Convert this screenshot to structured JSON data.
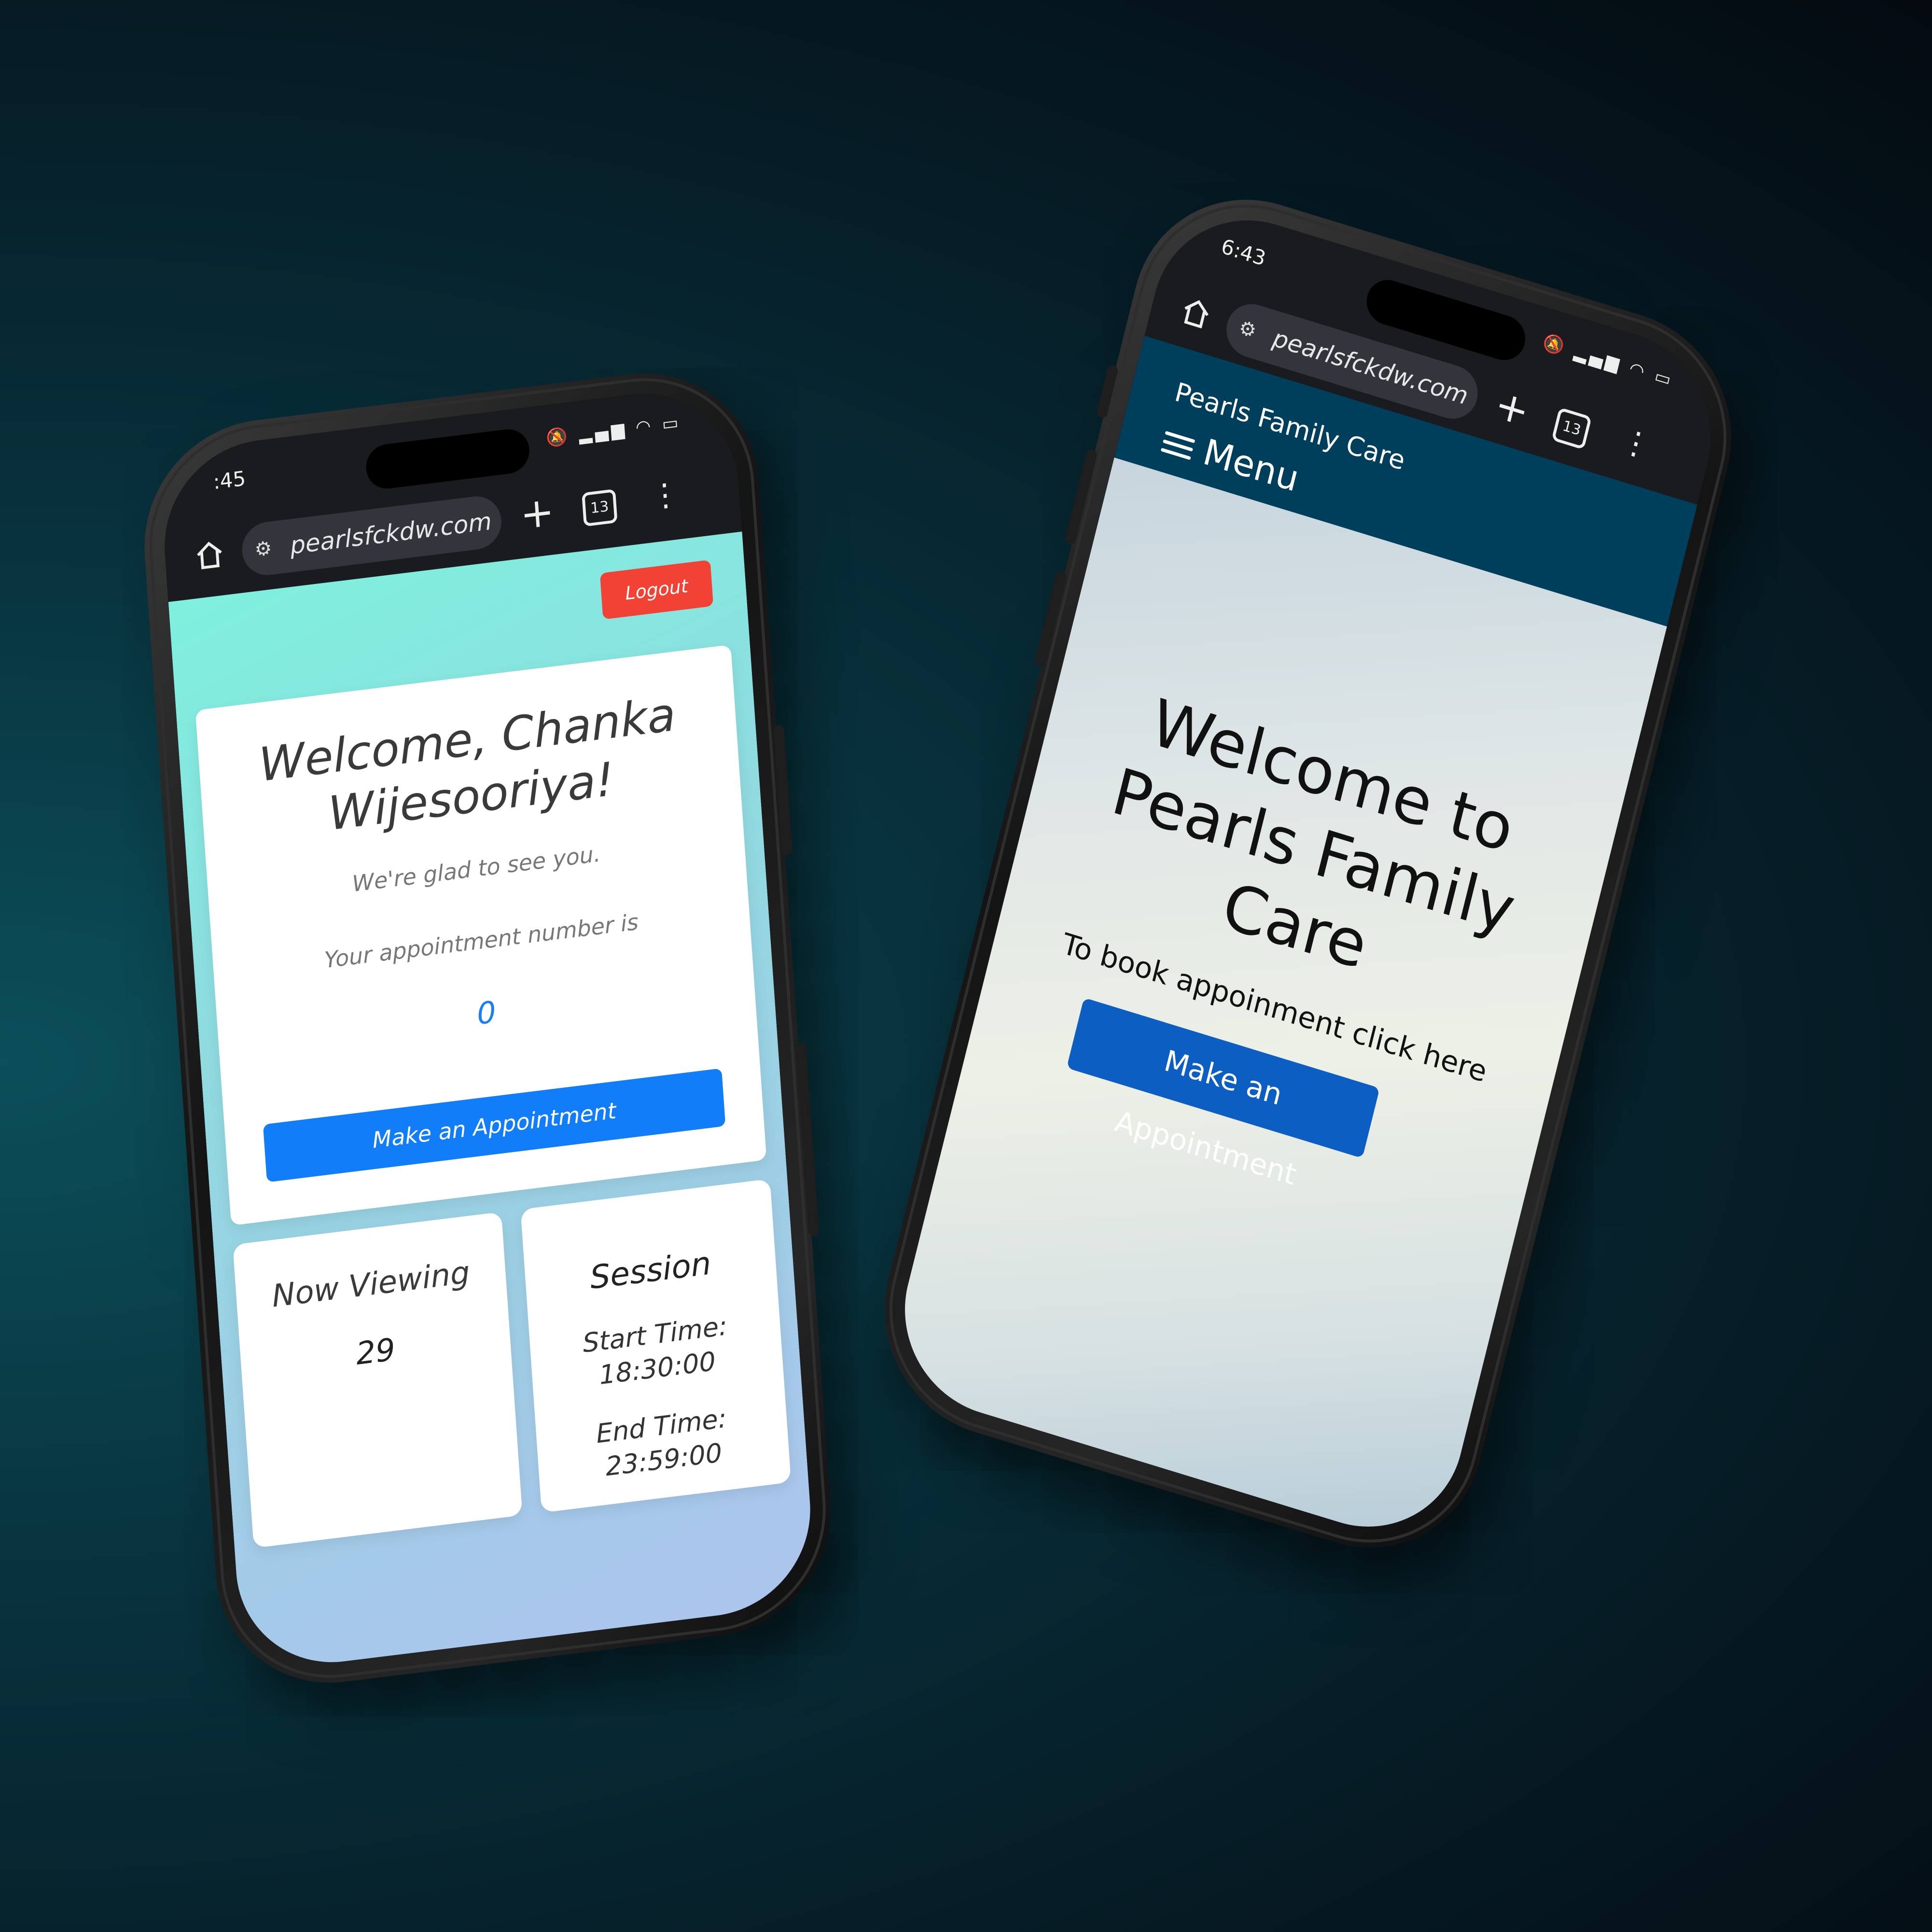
{
  "phone_left": {
    "status": {
      "time": ":45"
    },
    "browser": {
      "url": "pearlsfckdw.com",
      "tab_count": "13",
      "plus": "+",
      "more": "⋮"
    },
    "page": {
      "logout_label": "Logout",
      "welcome_line1": "Welcome, Chanka",
      "welcome_line2": "Wijesooriya!",
      "glad_text": "We're glad to see you.",
      "appointment_label": "Your appointment number is",
      "appointment_number": "0",
      "make_appointment_label": "Make an Appointment",
      "now_viewing_label": "Now Viewing",
      "now_viewing_value": "29",
      "session_label": "Session",
      "start_time_label": "Start Time:",
      "start_time_value": "18:30:00",
      "end_time_label": "End Time:",
      "end_time_value": "23:59:00"
    },
    "colors": {
      "logout": "#f24236",
      "primary": "#117df8",
      "accent_number": "#1a7ff0"
    }
  },
  "phone_right": {
    "status": {
      "time": "6:43"
    },
    "browser": {
      "url": "pearlsfckdw.com",
      "tab_count": "13",
      "plus": "+",
      "more": "⋮"
    },
    "page": {
      "brand": "Pearls Family Care",
      "menu_label": "Menu",
      "hero_line1": "Welcome to",
      "hero_line2": "Pearls Family",
      "hero_line3": "Care",
      "hero_sub": "To book appoinment click here",
      "make_appointment_label": "Make an Appointment"
    },
    "colors": {
      "header": "#003f5c",
      "button": "#0d5ec3"
    }
  }
}
